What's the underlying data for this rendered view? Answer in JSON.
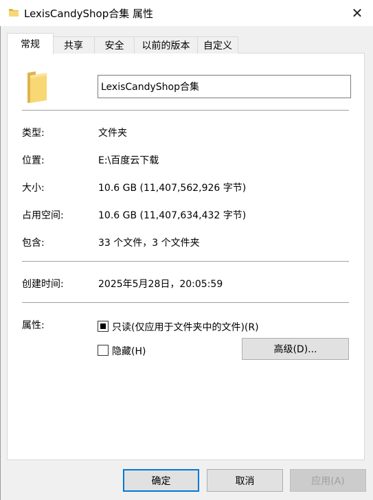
{
  "window": {
    "title": "LexisCandyShop合集 属性",
    "close_glyph": "✕"
  },
  "tabs": [
    {
      "label": "常规",
      "active": true
    },
    {
      "label": "共享",
      "active": false
    },
    {
      "label": "安全",
      "active": false
    },
    {
      "label": "以前的版本",
      "active": false
    },
    {
      "label": "自定义",
      "active": false
    }
  ],
  "general": {
    "name_value": "LexisCandyShop合集",
    "type_label": "类型:",
    "type_value": "文件夹",
    "location_label": "位置:",
    "location_value": "E:\\百度云下载",
    "size_label": "大小:",
    "size_value": "10.6 GB (11,407,562,926 字节)",
    "disk_size_label": "占用空间:",
    "disk_size_value": "10.6 GB (11,407,634,432 字节)",
    "contains_label": "包含:",
    "contains_value": "33 个文件，3 个文件夹",
    "created_label": "创建时间:",
    "created_value": "2025年5月28日，20:05:59",
    "attributes_label": "属性:",
    "readonly_label": "只读(仅应用于文件夹中的文件)(R)",
    "readonly_state": "indeterminate",
    "hidden_label": "隐藏(H)",
    "hidden_checked": false,
    "advanced_button": "高级(D)..."
  },
  "footer": {
    "ok": "确定",
    "cancel": "取消",
    "apply": "应用(A)"
  },
  "colors": {
    "folder_yellow": "#f8d775",
    "folder_dark": "#e0b24a",
    "focus_blue": "#0078d7"
  },
  "icons": {
    "title": "folder-icon",
    "large": "folder-icon",
    "close": "close-icon"
  }
}
